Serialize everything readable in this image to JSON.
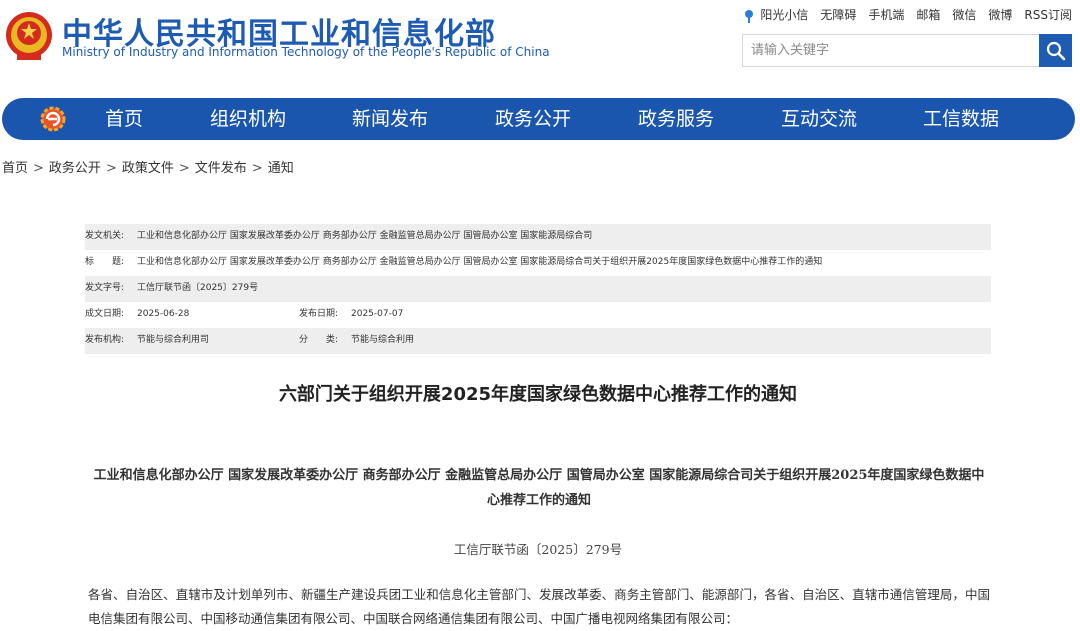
{
  "header": {
    "site_title_cn": "中华人民共和国工业和信息化部",
    "site_title_en": "Ministry of Industry and Information Technology of the People's Republic of China",
    "top_links": [
      "阳光小信",
      "无障碍",
      "手机端",
      "邮箱",
      "微信",
      "微博",
      "RSS订阅"
    ],
    "search": {
      "placeholder": "请输入关键字",
      "value": ""
    }
  },
  "nav": {
    "items": [
      "首页",
      "组织机构",
      "新闻发布",
      "政务公开",
      "政务服务",
      "互动交流",
      "工信数据"
    ]
  },
  "breadcrumb": [
    "首页",
    "政务公开",
    "政策文件",
    "文件发布",
    "通知"
  ],
  "info": {
    "issuer_label": "发文机关:",
    "issuer_value": "工业和信息化部办公厅 国家发展改革委办公厅 商务部办公厅 金融监管总局办公厅 国管局办公室 国家能源局综合司",
    "title_label": "标　　题:",
    "title_value": "工业和信息化部办公厅 国家发展改革委办公厅 商务部办公厅 金融监管总局办公厅 国管局办公室 国家能源局综合司关于组织开展2025年度国家绿色数据中心推荐工作的通知",
    "doc_no_label": "发文字号:",
    "doc_no_value": "工信厅联节函〔2025〕279号",
    "created_label": "成文日期:",
    "created_value": "2025-06-28",
    "published_label": "发布日期:",
    "published_value": "2025-07-07",
    "agency_label": "发布机构:",
    "agency_value": "节能与综合利用司",
    "category_label": "分　　类:",
    "category_value": "节能与综合利用"
  },
  "article": {
    "title": "六部门关于组织开展2025年度国家绿色数据中心推荐工作的通知",
    "subtitle": "工业和信息化部办公厅 国家发展改革委办公厅 商务部办公厅 金融监管总局办公厅 国管局办公室 国家能源局综合司关于组织开展2025年度国家绿色数据中心推荐工作的通知",
    "doc_number": "工信厅联节函〔2025〕279号",
    "body": "各省、自治区、直辖市及计划单列市、新疆生产建设兵团工业和信息化主管部门、发展改革委、商务主管部门、能源部门，各省、自治区、直辖市通信管理局，中国电信集团有限公司、中国移动通信集团有限公司、中国联合网络通信集团有限公司、中国广播电视网络集团有限公司："
  },
  "colors": {
    "brand_blue": "#1a56ae",
    "info_shade": "#eeeeee"
  },
  "icons": [
    "national-emblem-icon",
    "sun-icon",
    "search-icon",
    "nav-logo-icon"
  ]
}
